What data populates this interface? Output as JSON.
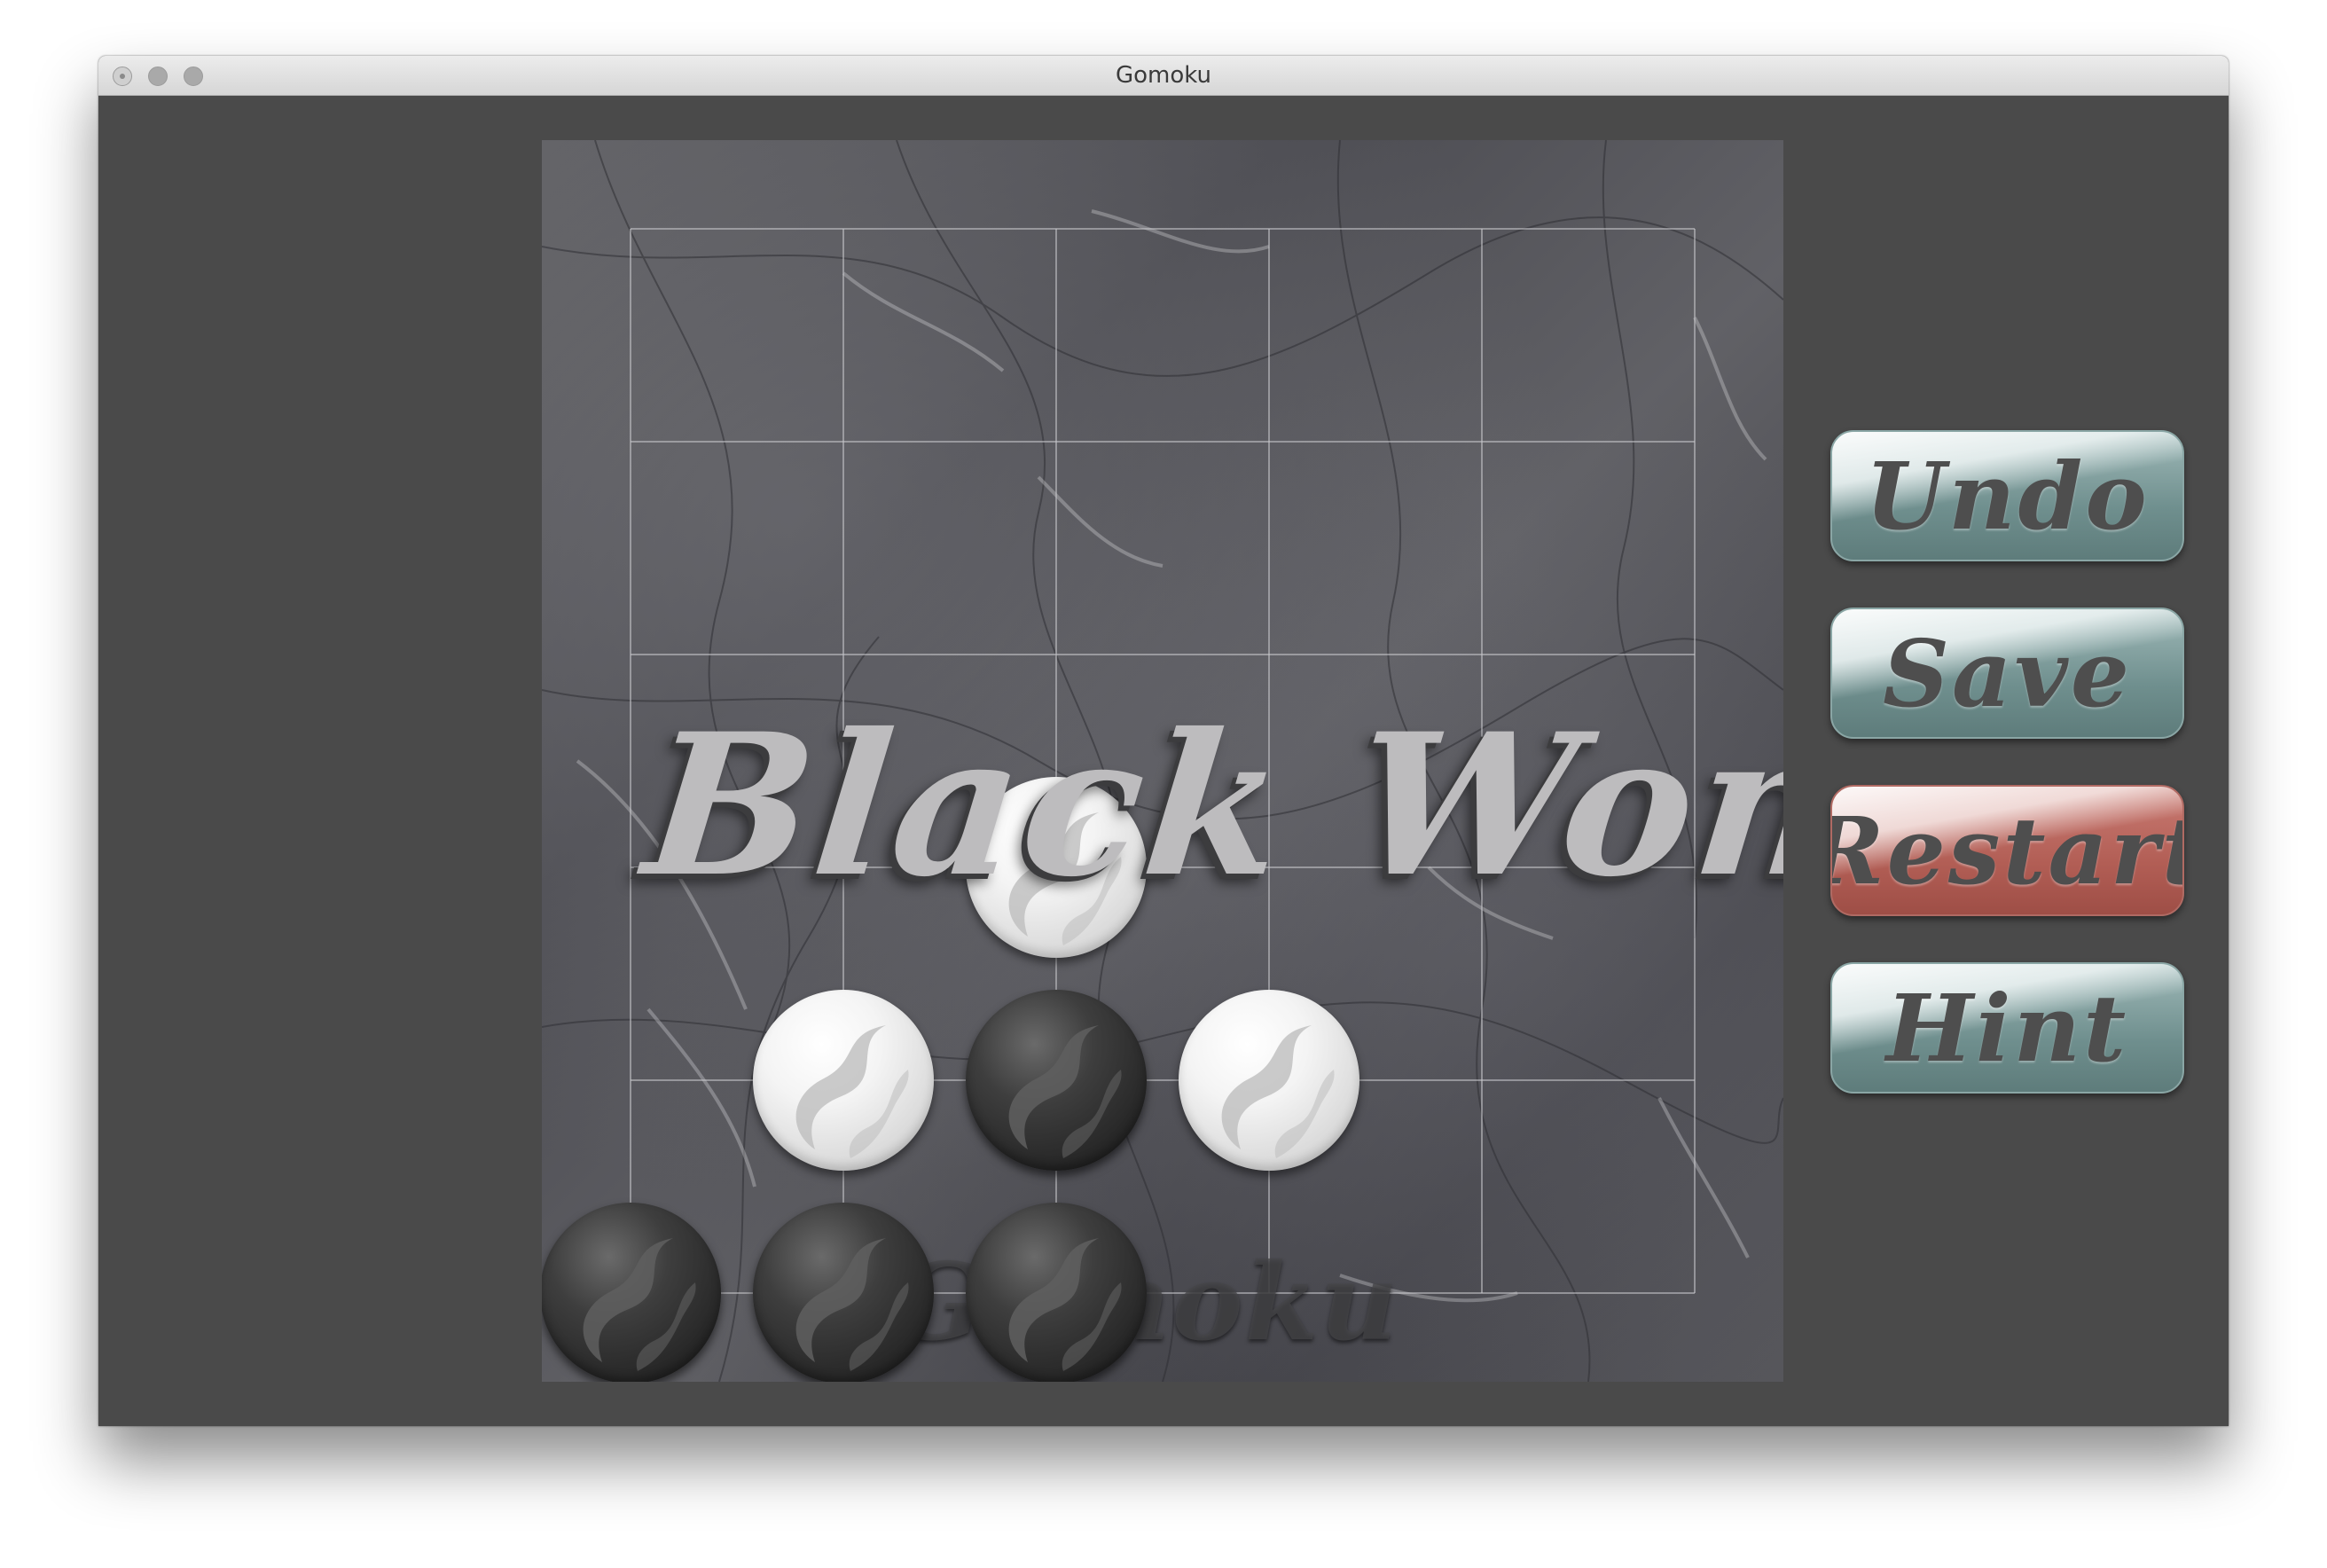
{
  "window": {
    "title": "Gomoku"
  },
  "board": {
    "size": 6,
    "stones": [
      {
        "color": "white",
        "col": 2,
        "row": 3
      },
      {
        "color": "white",
        "col": 1,
        "row": 4
      },
      {
        "color": "black",
        "col": 2,
        "row": 4
      },
      {
        "color": "white",
        "col": 3,
        "row": 4
      },
      {
        "color": "black",
        "col": 0,
        "row": 5
      },
      {
        "color": "black",
        "col": 1,
        "row": 5
      },
      {
        "color": "black",
        "col": 2,
        "row": 5
      }
    ],
    "watermark": "Gomoku",
    "result_text": "Black Won!"
  },
  "buttons": {
    "undo": {
      "label": "Undo",
      "color": "#7f9d9c"
    },
    "save": {
      "label": "Save",
      "color": "#7f9d9c"
    },
    "restart": {
      "label": "Restart",
      "color": "#b5625a"
    },
    "hint": {
      "label": "Hint",
      "color": "#7f9d9c"
    }
  }
}
